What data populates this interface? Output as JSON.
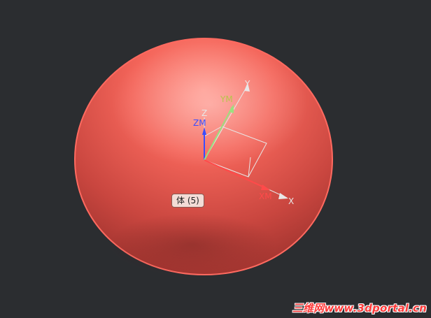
{
  "viewport": {
    "background": "#2b2d30"
  },
  "body": {
    "color": "#e8625a",
    "tooltip_label": "体 (5)"
  },
  "csys": {
    "wcs_axes": [
      "X",
      "Y",
      "Z"
    ],
    "work_axes": [
      "XM",
      "YM",
      "ZM"
    ],
    "colors": {
      "xm": "#ff4a4a",
      "ym": "#9be07f",
      "zm": "#3a4dff",
      "wcs": "#e8e8e8"
    }
  },
  "watermark": {
    "text": "三维网www.3dportal.cn"
  }
}
